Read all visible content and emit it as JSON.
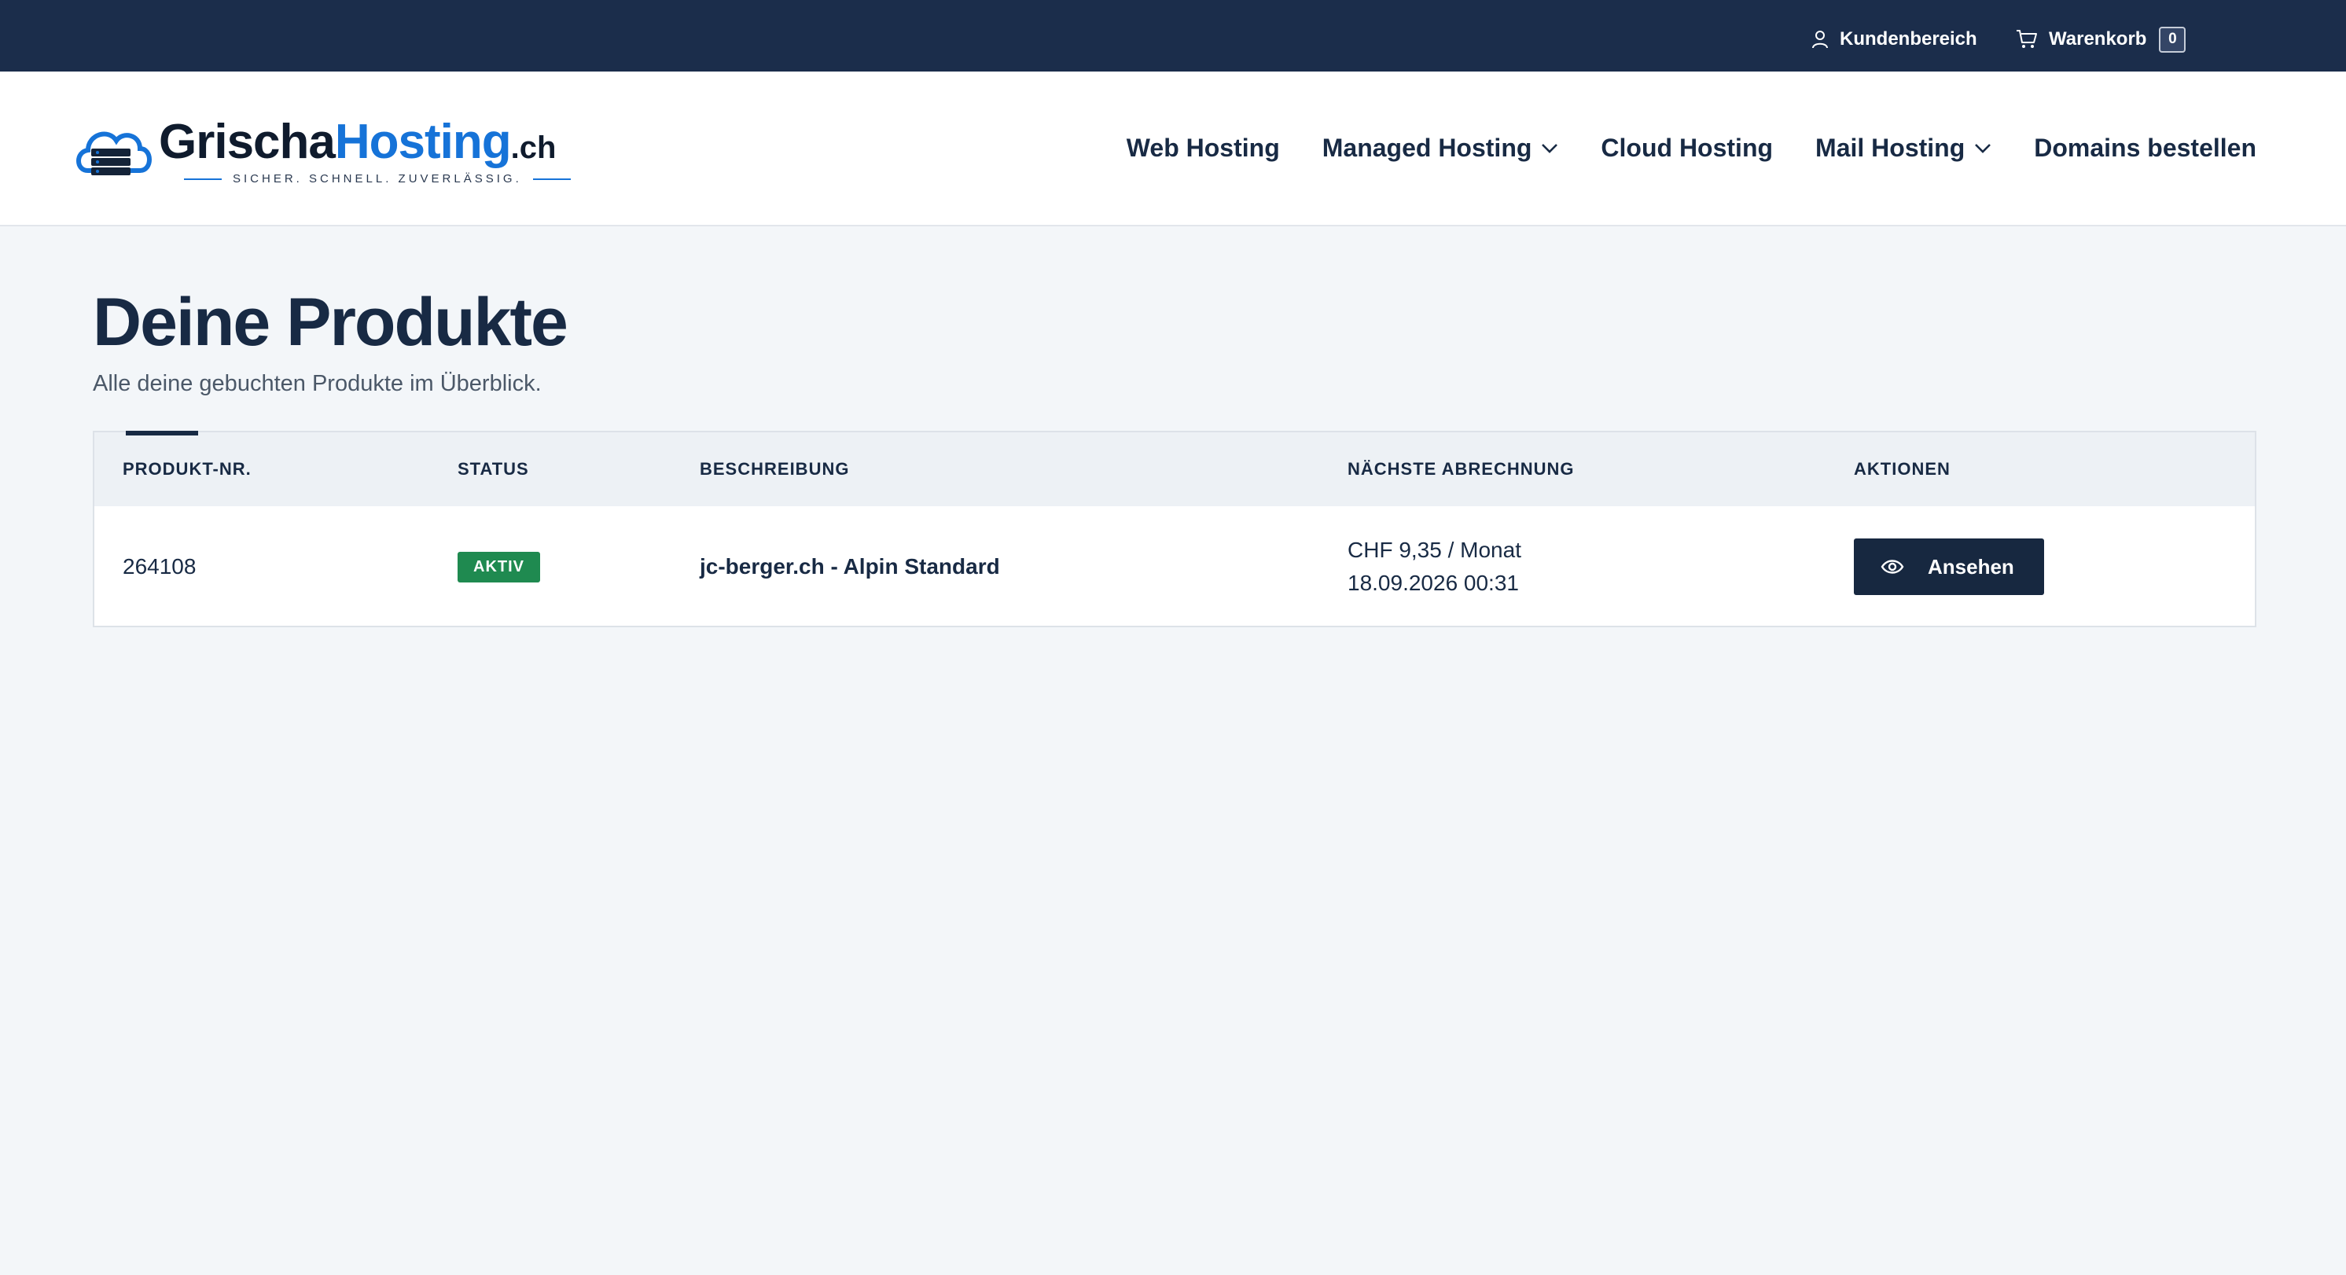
{
  "topbar": {
    "account_label": "Kundenbereich",
    "cart_label": "Warenkorb",
    "cart_count": "0"
  },
  "logo": {
    "part1": "Grischa",
    "part2": "Hosting",
    "part3": ".ch",
    "tagline": "SICHER. SCHNELL. ZUVERLÄSSIG.",
    "colors": {
      "dark": "#0f1b2d",
      "brand": "#1673d8"
    }
  },
  "nav": {
    "items": [
      {
        "label": "Web Hosting",
        "dropdown": false
      },
      {
        "label": "Managed Hosting",
        "dropdown": true
      },
      {
        "label": "Cloud Hosting",
        "dropdown": false
      },
      {
        "label": "Mail Hosting",
        "dropdown": true
      },
      {
        "label": "Domains bestellen",
        "dropdown": false
      }
    ]
  },
  "page": {
    "title": "Deine Produkte",
    "subtitle": "Alle deine gebuchten Produkte im Überblick."
  },
  "table": {
    "headers": [
      "PRODUKT-NR.",
      "STATUS",
      "BESCHREIBUNG",
      "NÄCHSTE ABRECHNUNG",
      "AKTIONEN"
    ],
    "rows": [
      {
        "product_no": "264108",
        "status": "AKTIV",
        "description": "jc-berger.ch - Alpin Standard",
        "price": "CHF 9,35 / Monat",
        "next_billing": "18.09.2026 00:31",
        "action_label": "Ansehen"
      }
    ]
  },
  "colors": {
    "topbar": "#1b2d4b",
    "status_active": "#1f8a50",
    "button": "#172840"
  }
}
